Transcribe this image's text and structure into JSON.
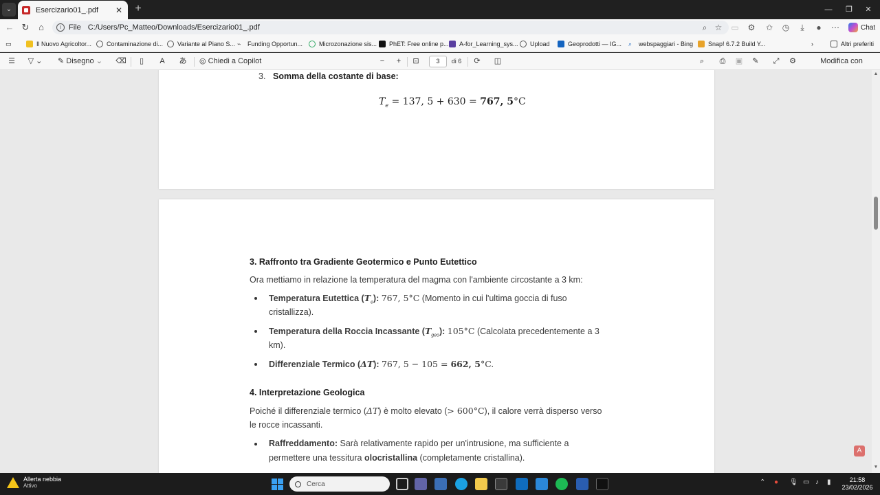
{
  "browser": {
    "tab_title": "Esercizario01_.pdf",
    "scheme": "File",
    "url": "C:/Users/Pc_Matteo/Downloads/Esercizario01_.pdf",
    "chat_label": "Chat",
    "favorites": [
      "Il Nuovo Agricoltor...",
      "Contaminazione di...",
      "Variante al Piano S...",
      "Funding Opportun...",
      "Microzonazione sis...",
      "PhET: Free online p...",
      "A-for_Learning_sys...",
      "Upload",
      "Geoprodotti — IG...",
      "webspaggiari - Bing",
      "Snap! 6.7.2 Build Y..."
    ],
    "other_favorites": "Altri preferiti"
  },
  "pdf_toolbar": {
    "draw_label": "Disegno",
    "copilot_label": "Chiedi a Copilot",
    "page_current": "3",
    "page_total": "di 6",
    "acrobat_label": "Modifica con Acrobat"
  },
  "page_top": {
    "step_number": "3.",
    "step_title": "Somma della costante di base:",
    "formula_lhs": "T",
    "formula_sub": "e",
    "formula_rhs": "= 137, 5 + 630 = ",
    "formula_result": "767, 5",
    "formula_unit": "°C"
  },
  "page_main": {
    "section3_title": "3. Raffronto tra Gradiente Geotermico e Punto Eutettico",
    "section3_intro": "Ora mettiamo in relazione la temperatura del magma con l'ambiente circostante a 3 km:",
    "bullets": [
      {
        "label": "Temperatura Eutettica (",
        "sym": "T",
        "sub": "e",
        "label_end": "):",
        "value": "767, 5°C",
        "note_line1": "(Momento in cui l'ultima goccia di fuso",
        "note_line2": "cristallizza)."
      },
      {
        "label": "Temperatura della Roccia Incassante (",
        "sym": "T",
        "sub": "geo",
        "label_end": "):",
        "value": "105°C",
        "note_line1": "(Calcolata precedentemente a 3",
        "note_line2": "km)."
      },
      {
        "label": "Differenziale Termico (",
        "sym": "ΔT",
        "label_end": "):",
        "value": "767, 5 − 105 = ",
        "value_bold": "662, 5",
        "value_end": "°C."
      }
    ],
    "section4_title": "4. Interpretazione Geologica",
    "section4_p1_a": "Poiché il differenziale termico (",
    "section4_p1_sym": "ΔT",
    "section4_p1_b": ") è molto elevato (",
    "section4_p1_math": "> 600°C",
    "section4_p1_c": "), il calore verrà disperso verso",
    "section4_p1_line2": "le rocce incassanti.",
    "cooling_label": "Raffreddamento:",
    "cooling_text1": "Sarà relativamente rapido per un'intrusione, ma sufficiente a",
    "cooling_text2a": "permettere una tessitura ",
    "cooling_bold": "olocristallina",
    "cooling_text2b": " (completamente cristallina)."
  },
  "taskbar": {
    "weather_title": "Allerta nebbia",
    "weather_status": "Attivo",
    "search_placeholder": "Cerca",
    "time": "21:58",
    "date": "23/02/2026"
  }
}
